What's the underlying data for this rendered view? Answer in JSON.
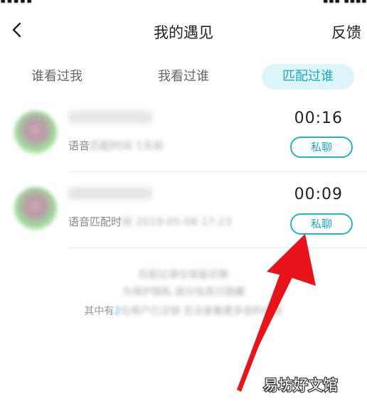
{
  "header": {
    "title": "我的遇见",
    "feedback_label": "反馈",
    "back_icon": "chevron-left-icon"
  },
  "tabs": [
    {
      "label": "谁看过我",
      "active": false
    },
    {
      "label": "我看过谁",
      "active": false
    },
    {
      "label": "匹配过谁",
      "active": true
    }
  ],
  "matches": [
    {
      "sub_prefix": "语音",
      "time": "00:16",
      "chat_label": "私聊"
    },
    {
      "sub_prefix": "语音匹配时",
      "time": "00:09",
      "chat_label": "私聊"
    }
  ],
  "notice": {
    "prefix": "其中有",
    "digit": "2"
  },
  "watermark": {
    "text": "易坊好文馆"
  },
  "colors": {
    "accent": "#1aa9c0",
    "active_tab_bg": "#ddf5f8",
    "arrow": "#e8141b"
  }
}
